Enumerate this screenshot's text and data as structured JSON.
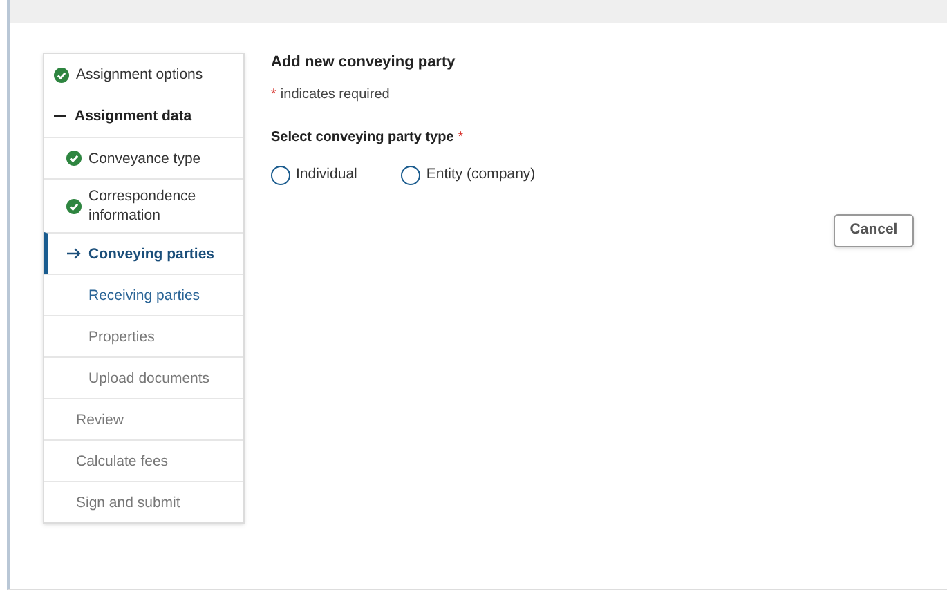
{
  "steps": [
    {
      "label": "Assignment options",
      "completed": true,
      "selected": false,
      "disabled": false
    },
    {
      "label": "Assignment data",
      "expanded": true,
      "children": [
        {
          "label": "Conveyance type",
          "completed": true,
          "selected": false,
          "disabled": false
        },
        {
          "label": "Correspondence information",
          "completed": true,
          "selected": false,
          "disabled": false
        },
        {
          "label": "Conveying parties",
          "completed": false,
          "selected": true,
          "disabled": false
        },
        {
          "label": "Receiving parties",
          "completed": false,
          "selected": false,
          "disabled": false
        },
        {
          "label": "Properties",
          "completed": false,
          "selected": false,
          "disabled": true
        },
        {
          "label": "Upload documents",
          "completed": false,
          "selected": false,
          "disabled": true
        }
      ]
    },
    {
      "label": "Review",
      "completed": false,
      "selected": false,
      "disabled": true
    },
    {
      "label": "Calculate fees",
      "completed": false,
      "selected": false,
      "disabled": true
    },
    {
      "label": "Sign and submit",
      "completed": false,
      "selected": false,
      "disabled": true
    }
  ],
  "form": {
    "title": "Add new conveying party",
    "required_note": {
      "mark": "*",
      "text": "indicates required"
    },
    "question": {
      "label": "Select conveying party type",
      "mark": "*"
    },
    "options": [
      {
        "label": "Individual",
        "selected": false
      },
      {
        "label": "Entity (company)",
        "selected": false
      }
    ]
  },
  "buttons": [
    {
      "label": "Cancel"
    }
  ]
}
